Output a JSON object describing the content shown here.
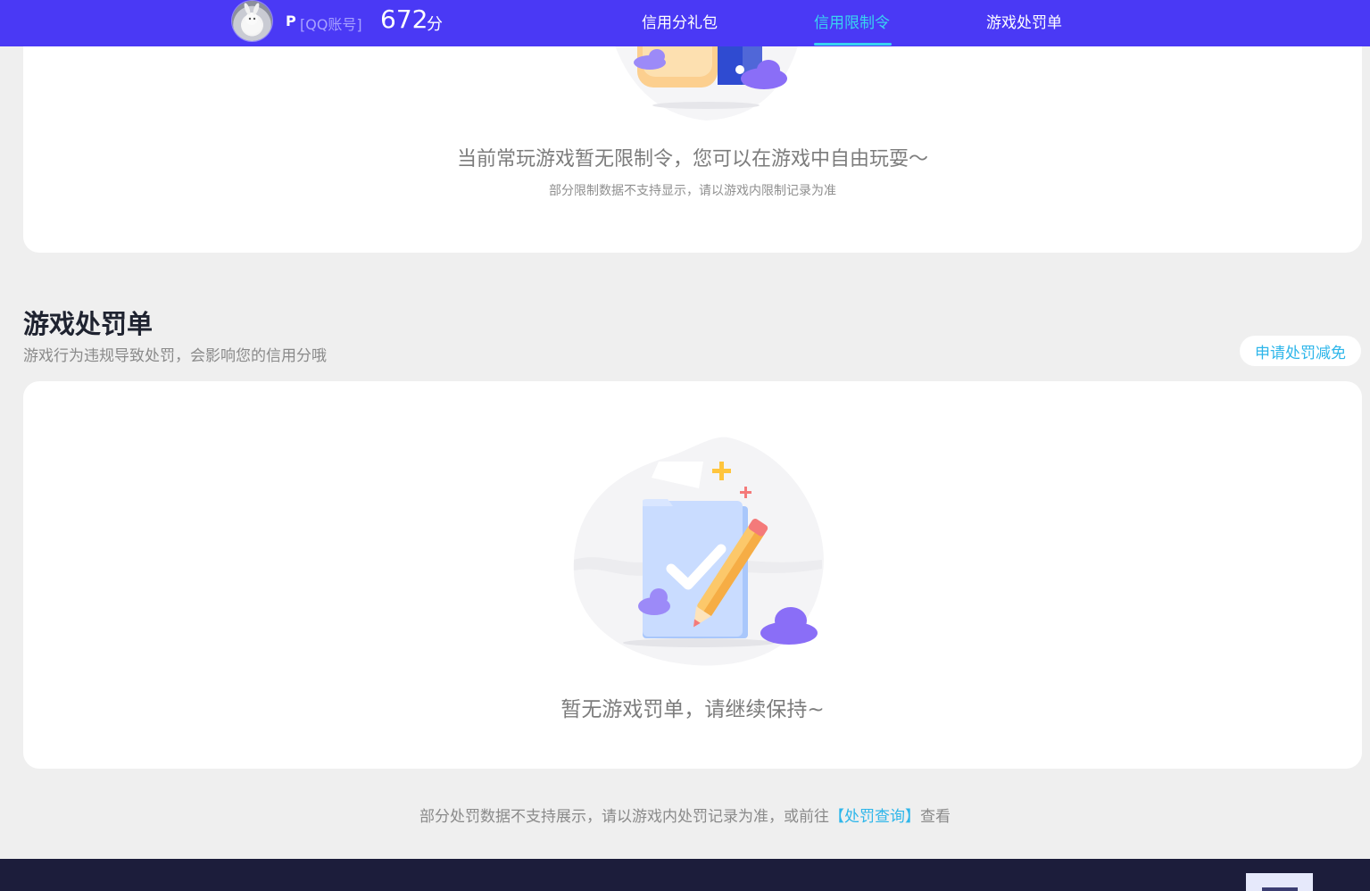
{
  "header": {
    "user_name": "P",
    "account_type": "[QQ账号]",
    "score": "672",
    "score_unit": "分",
    "nav": [
      {
        "label": "信用分礼包",
        "active": false
      },
      {
        "label": "信用限制令",
        "active": true
      },
      {
        "label": "游戏处罚单",
        "active": false
      }
    ]
  },
  "restriction": {
    "empty_title": "当前常玩游戏暂无限制令，您可以在游戏中自由玩耍～",
    "empty_subtitle": "部分限制数据不支持显示，请以游戏内限制记录为准"
  },
  "punishment": {
    "title": "游戏处罚单",
    "description": "游戏行为违规导致处罚，会影响您的信用分哦",
    "appeal_button": "申请处罚减免",
    "empty_title": "暂无游戏罚单，请继续保持~"
  },
  "footer": {
    "note_prefix": "部分处罚数据不支持展示，请以游戏内处罚记录为准，或前往",
    "link_label": "【处罚查询】",
    "note_suffix": "查看"
  },
  "colors": {
    "header_bg": "#4a39f5",
    "accent": "#39d3f0",
    "link": "#2eb6ea",
    "page_bg": "#efefef",
    "bottom_bar": "#1c1d3b"
  },
  "icons": [
    "avatar",
    "restriction-empty-illustration",
    "punishment-empty-illustration"
  ]
}
